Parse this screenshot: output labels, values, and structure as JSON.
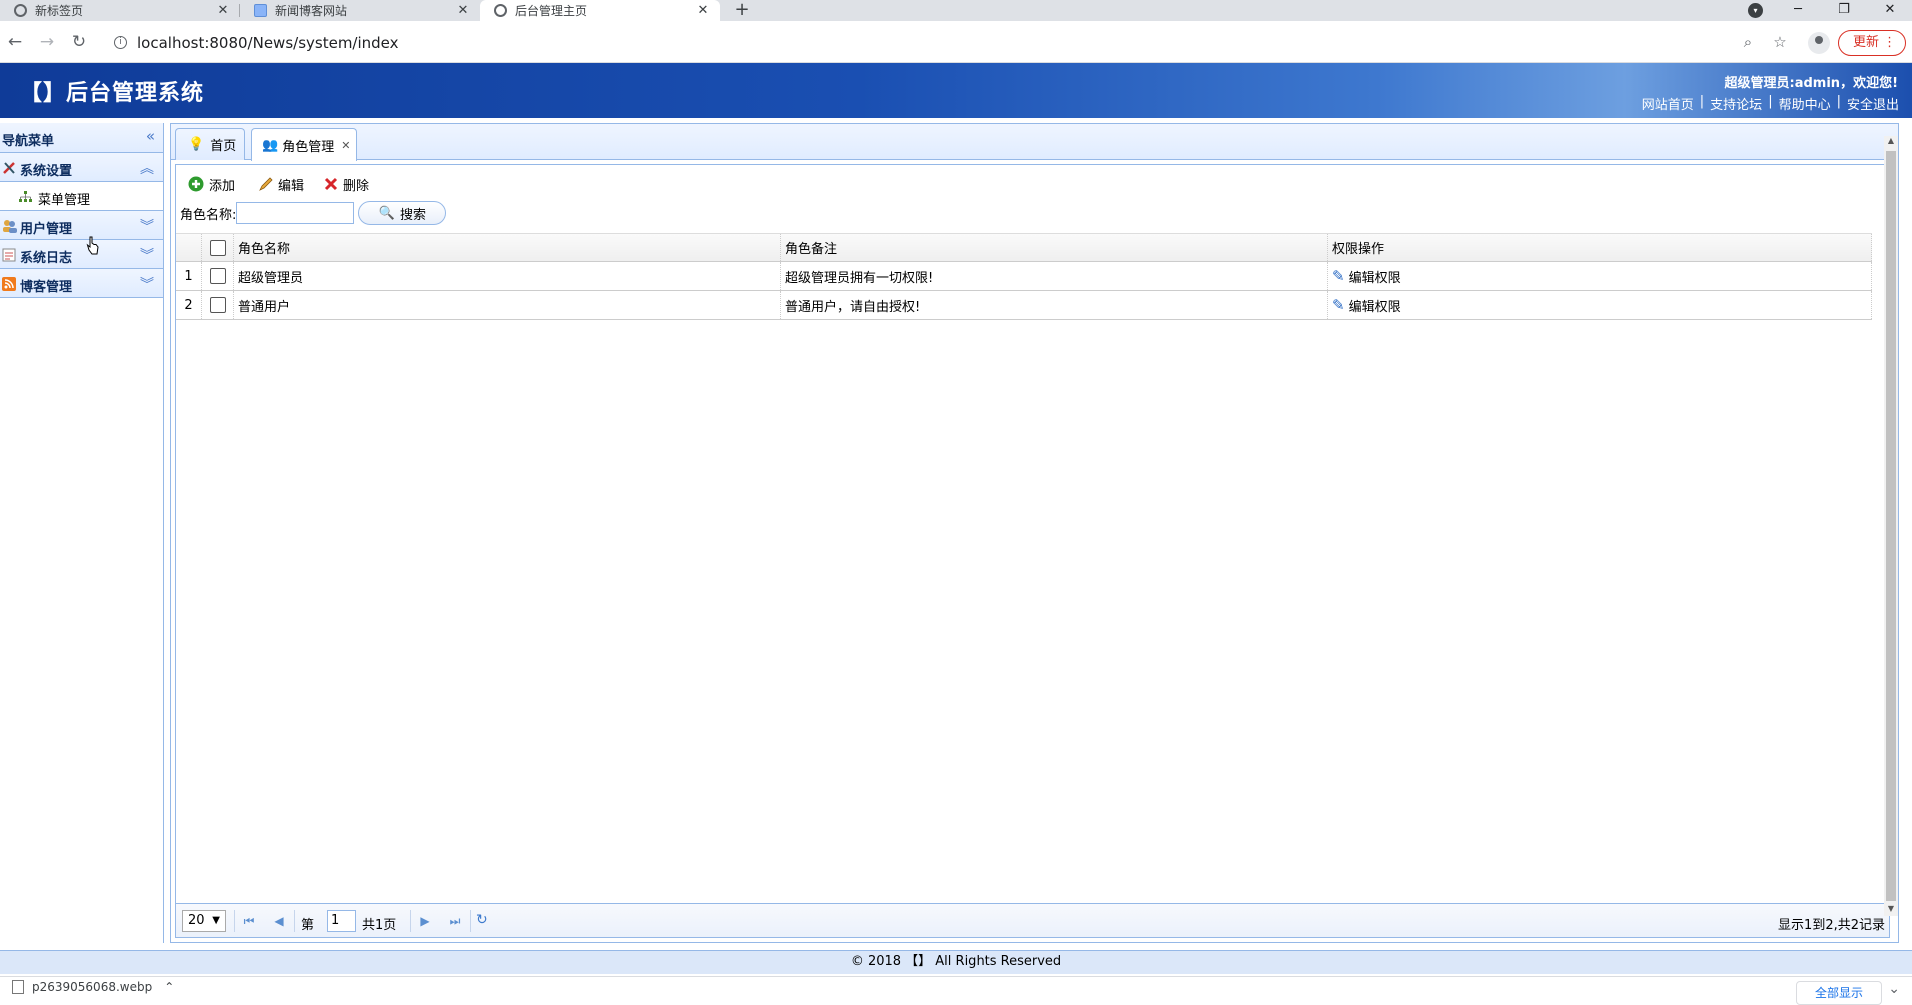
{
  "browser": {
    "tabs": [
      {
        "title": "新标签页"
      },
      {
        "title": "新闻博客网站"
      },
      {
        "title": "后台管理主页"
      }
    ],
    "url": "localhost:8080/News/system/index",
    "update_label": "更新",
    "new_tab": "+"
  },
  "header": {
    "title": "【】后台管理系统",
    "welcome": "超级管理员:admin，欢迎您!",
    "links": [
      "网站首页",
      "支持论坛",
      "帮助中心",
      "安全退出"
    ]
  },
  "nav": {
    "title": "导航菜单",
    "sections": [
      {
        "label": "系统设置",
        "items": [
          {
            "label": "菜单管理"
          }
        ]
      },
      {
        "label": "用户管理"
      },
      {
        "label": "系统日志"
      },
      {
        "label": "博客管理"
      }
    ]
  },
  "tabs": [
    {
      "label": "首页"
    },
    {
      "label": "角色管理"
    }
  ],
  "toolbar": {
    "add": "添加",
    "edit": "编辑",
    "delete": "删除",
    "search_label": "角色名称:",
    "search_value": "",
    "search_button": "搜索"
  },
  "grid": {
    "columns": [
      "角色名称",
      "角色备注",
      "权限操作"
    ],
    "rows": [
      {
        "num": "1",
        "name": "超级管理员",
        "note": "超级管理员拥有一切权限!",
        "action": "编辑权限"
      },
      {
        "num": "2",
        "name": "普通用户",
        "note": "普通用户，请自由授权!",
        "action": "编辑权限"
      }
    ]
  },
  "pager": {
    "page_size": "20",
    "page_prefix": "第",
    "page_value": "1",
    "page_total": "共1页",
    "summary": "显示1到2,共2记录"
  },
  "footer": {
    "text": "© 2018 【】 All Rights Reserved"
  },
  "downloads": {
    "file": "p2639056068.webp",
    "show_all": "全部显示"
  },
  "colors": {
    "header_blue": "#1a4fb2",
    "panel_border": "#95b8e7",
    "accent": "#e0ecff",
    "update_red": "#d93025"
  }
}
